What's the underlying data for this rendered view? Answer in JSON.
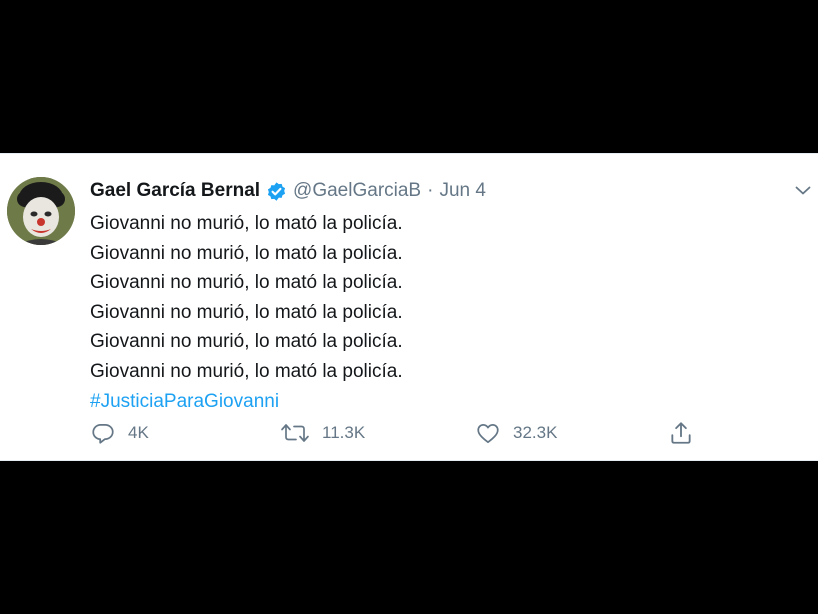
{
  "tweet": {
    "author_name": "Gael García Bernal",
    "handle": "@GaelGarciaB",
    "separator": "·",
    "date": "Jun 4",
    "lines": [
      "Giovanni no murió, lo mató la policía.",
      "Giovanni no murió, lo mató la policía.",
      "Giovanni no murió, lo mató la policía.",
      "Giovanni no murió, lo mató la policía.",
      "Giovanni no murió, lo mató la policía.",
      "Giovanni no murió, lo mató la policía."
    ],
    "hashtag": "#JusticiaParaGiovanni",
    "actions": {
      "reply_count": "4K",
      "retweet_count": "11.3K",
      "like_count": "32.3K"
    },
    "icons": {
      "verified": "verified-badge-icon",
      "menu": "chevron-down-icon",
      "reply": "reply-icon",
      "retweet": "retweet-icon",
      "like": "heart-icon",
      "share": "share-icon"
    }
  },
  "colors": {
    "background": "#000000",
    "card": "#ffffff",
    "text": "#14171a",
    "secondary": "#657786",
    "accent": "#1da1f2"
  }
}
